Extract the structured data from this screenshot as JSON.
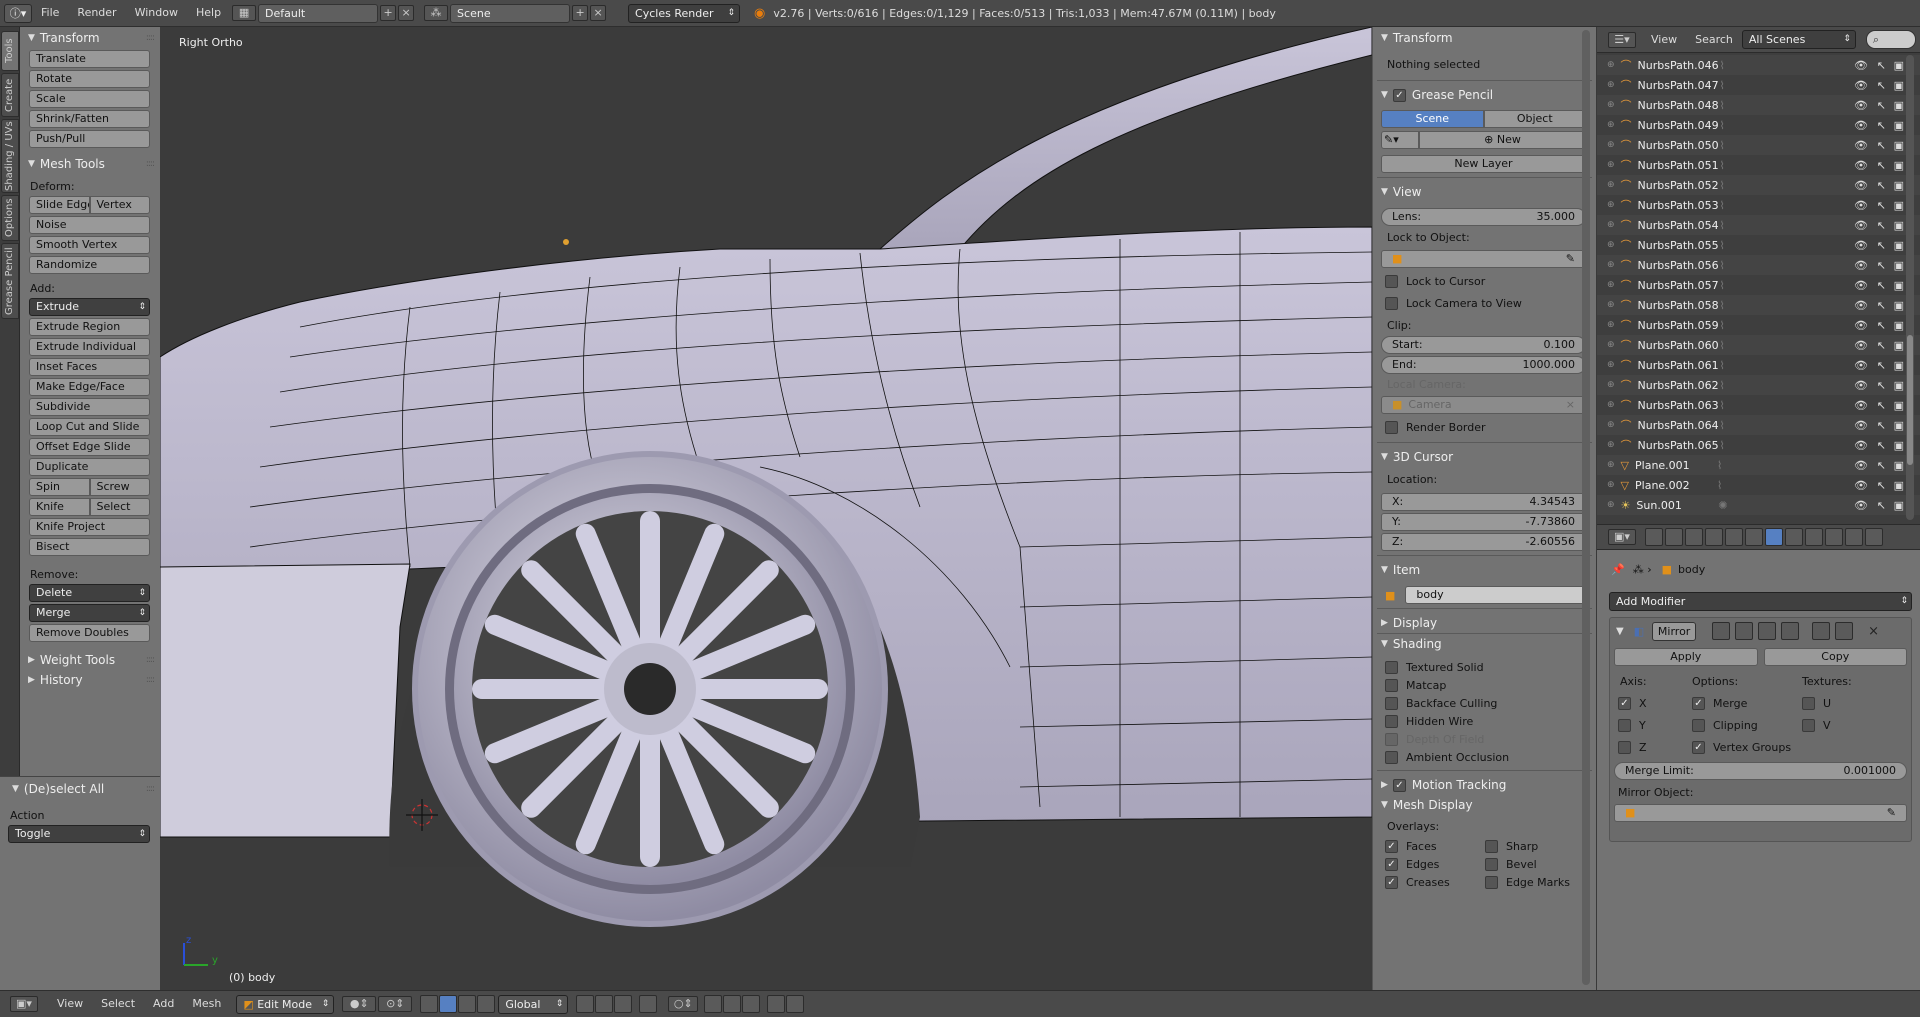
{
  "topbar": {
    "menus": [
      "File",
      "Render",
      "Window",
      "Help"
    ],
    "layout": "Default",
    "scene": "Scene",
    "engine": "Cycles Render",
    "stats": "v2.76 | Verts:0/616 | Edges:0/1,129 | Faces:0/513 | Tris:1,033 | Mem:47.67M (0.11M) | body"
  },
  "lefttabs": [
    "Tools",
    "Create",
    "Shading / UVs",
    "Options",
    "Grease Pencil"
  ],
  "toolshelf": {
    "transform_title": "Transform",
    "transform_buttons": [
      "Translate",
      "Rotate",
      "Scale",
      "Shrink/Fatten",
      "Push/Pull"
    ],
    "mesh_tools_title": "Mesh Tools",
    "deform_label": "Deform:",
    "slide_edge": "Slide Edge",
    "vertex": "Vertex",
    "deform_buttons": [
      "Noise",
      "Smooth Vertex",
      "Randomize"
    ],
    "add_label": "Add:",
    "extrude": "Extrude",
    "add_buttons": [
      "Extrude Region",
      "Extrude Individual",
      "Inset Faces",
      "Make Edge/Face",
      "Subdivide",
      "Loop Cut and Slide",
      "Offset Edge Slide",
      "Duplicate"
    ],
    "spin": "Spin",
    "screw": "Screw",
    "knife": "Knife",
    "select": "Select",
    "knife_project": "Knife Project",
    "bisect": "Bisect",
    "remove_label": "Remove:",
    "delete": "Delete",
    "merge": "Merge",
    "remove_doubles": "Remove Doubles",
    "weight_tools": "Weight Tools",
    "history": "History",
    "deselect_all": "(De)select All",
    "action_label": "Action",
    "action_value": "Toggle"
  },
  "viewport": {
    "view_name": "Right Ortho",
    "object_label": "(0) body",
    "axis_z": "z",
    "axis_y": "y"
  },
  "npanel": {
    "transform_title": "Transform",
    "nothing_selected": "Nothing selected",
    "grease_pencil_title": "Grease Pencil",
    "scene_btn": "Scene",
    "object_btn": "Object",
    "new_btn": "New",
    "new_layer_btn": "New Layer",
    "view_title": "View",
    "lens_label": "Lens:",
    "lens_value": "35.000",
    "lock_to_object": "Lock to Object:",
    "lock_to_cursor": "Lock to Cursor",
    "lock_camera_to_view": "Lock Camera to View",
    "clip_label": "Clip:",
    "clip_start_label": "Start:",
    "clip_start_value": "0.100",
    "clip_end_label": "End:",
    "clip_end_value": "1000.000",
    "local_camera_label": "Local Camera:",
    "local_camera_value": "Camera",
    "render_border": "Render Border",
    "cursor_title": "3D Cursor",
    "location_label": "Location:",
    "x_label": "X:",
    "x_value": "4.34543",
    "y_label": "Y:",
    "y_value": "-7.73860",
    "z_label": "Z:",
    "z_value": "-2.60556",
    "item_title": "Item",
    "item_name": "body",
    "display_title": "Display",
    "shading_title": "Shading",
    "shading_opts": [
      "Textured Solid",
      "Matcap",
      "Backface Culling",
      "Hidden Wire",
      "Depth Of Field",
      "Ambient Occlusion"
    ],
    "motion_tracking_title": "Motion Tracking",
    "mesh_display_title": "Mesh Display",
    "overlays_label": "Overlays:",
    "overlay_left": [
      "Faces",
      "Edges",
      "Creases"
    ],
    "overlay_right": [
      "Sharp",
      "Bevel",
      "Edge Marks"
    ]
  },
  "outliner": {
    "view_menu": "View",
    "search_menu": "Search",
    "scene_select": "All Scenes",
    "rows": [
      "NurbsPath.046",
      "NurbsPath.047",
      "NurbsPath.048",
      "NurbsPath.049",
      "NurbsPath.050",
      "NurbsPath.051",
      "NurbsPath.052",
      "NurbsPath.053",
      "NurbsPath.054",
      "NurbsPath.055",
      "NurbsPath.056",
      "NurbsPath.057",
      "NurbsPath.058",
      "NurbsPath.059",
      "NurbsPath.060",
      "NurbsPath.061",
      "NurbsPath.062",
      "NurbsPath.063",
      "NurbsPath.064",
      "NurbsPath.065",
      "Plane.001",
      "Plane.002",
      "Sun.001"
    ]
  },
  "props": {
    "object_name": "body",
    "add_modifier": "Add Modifier",
    "modifier_name": "Mirror",
    "apply_btn": "Apply",
    "copy_btn": "Copy",
    "axis_label": "Axis:",
    "options_label": "Options:",
    "textures_label": "Textures:",
    "axis_x": "X",
    "axis_y": "Y",
    "axis_z": "Z",
    "opt_merge": "Merge",
    "opt_clipping": "Clipping",
    "opt_vgroups": "Vertex Groups",
    "tex_u": "U",
    "tex_v": "V",
    "merge_limit_label": "Merge Limit:",
    "merge_limit_value": "0.001000",
    "mirror_object_label": "Mirror Object:"
  },
  "bottombar": {
    "menus": [
      "View",
      "Select",
      "Add",
      "Mesh"
    ],
    "mode": "Edit Mode",
    "orientation": "Global"
  }
}
